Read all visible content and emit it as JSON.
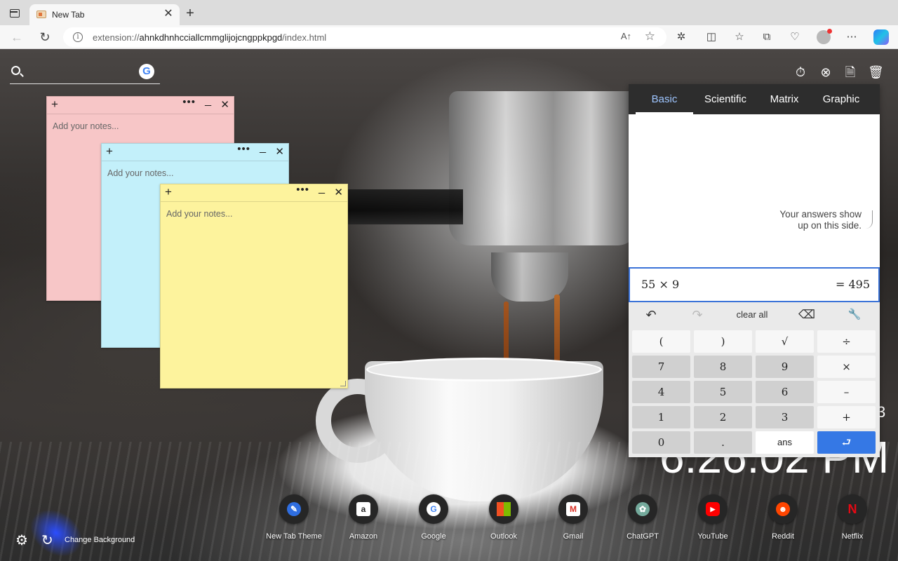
{
  "browser": {
    "tab_title": "New Tab",
    "new_tab_symbol": "+",
    "close_symbol": "✕",
    "url_prefix": "extension://",
    "url_host": "ahnkdhnhcciallcmmglijojcngppkpgd",
    "url_path": "/index.html",
    "read_aloud": "A↑"
  },
  "search": {
    "placeholder": "",
    "engine_letter": "G"
  },
  "notes": [
    {
      "color": "#f7c6c7",
      "placeholder": "Add your notes..."
    },
    {
      "color": "#c3f0fa",
      "placeholder": "Add your notes..."
    },
    {
      "color": "#fdf39d",
      "placeholder": "Add your notes..."
    }
  ],
  "note_controls": {
    "add": "+",
    "more": "•••",
    "minimize": "_",
    "close": "✕"
  },
  "calculator": {
    "tabs": [
      "Basic",
      "Scientific",
      "Matrix",
      "Graphic"
    ],
    "active_tab": "Basic",
    "hint_line1": "Your answers show",
    "hint_line2": "up on this side.",
    "expression": "55 × 9",
    "result": "= 495",
    "clear_all": "clear all",
    "undo": "↶",
    "redo": "↷",
    "backspace": "⌫",
    "settings": "🔧",
    "keys": {
      "open_paren": "(",
      "close_paren": ")",
      "sqrt": "√",
      "divide": "÷",
      "k7": "7",
      "k8": "8",
      "k9": "9",
      "multiply": "×",
      "k4": "4",
      "k5": "5",
      "k6": "6",
      "minus": "–",
      "k1": "1",
      "k2": "2",
      "k3": "3",
      "plus": "+",
      "k0": "0",
      "dot": ".",
      "ans": "ans",
      "enter": "⮐"
    }
  },
  "clock": {
    "time": "6:26:02 PM",
    "seconds_digit": "3"
  },
  "shortcuts": [
    {
      "label": "New Tab Theme",
      "glyph": "✎",
      "color": "#2f6ee0"
    },
    {
      "label": "Amazon",
      "glyph": "a",
      "color": "#ffffff"
    },
    {
      "label": "Google",
      "glyph": "G",
      "color": "#4285f4"
    },
    {
      "label": "Outlook",
      "glyph": "⊞",
      "color": "#f25022"
    },
    {
      "label": "Gmail",
      "glyph": "M",
      "color": "#d93025"
    },
    {
      "label": "ChatGPT",
      "glyph": "✿",
      "color": "#74aa9c"
    },
    {
      "label": "YouTube",
      "glyph": "▶",
      "color": "#ff0000"
    },
    {
      "label": "Reddit",
      "glyph": "☻",
      "color": "#ff4500"
    },
    {
      "label": "Netflix",
      "glyph": "N",
      "color": "#e50914"
    }
  ],
  "footer": {
    "change_background": "Change Background"
  }
}
